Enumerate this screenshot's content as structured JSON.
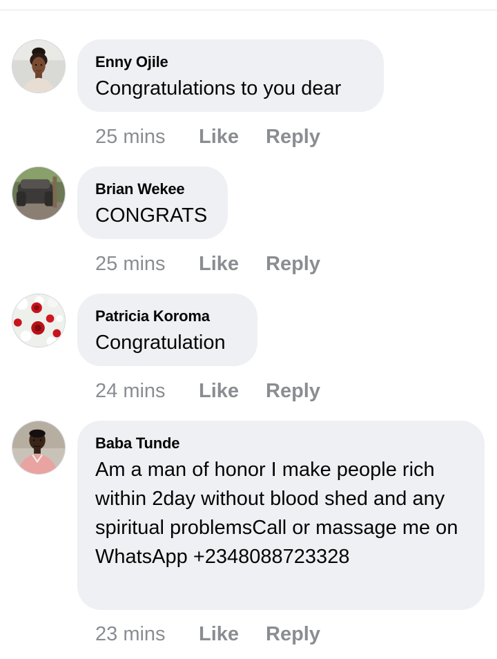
{
  "comments": [
    {
      "author": "Enny Ojile",
      "text": "Congratulations to you dear",
      "time": "25 mins",
      "like_label": "Like",
      "reply_label": "Reply",
      "avatar_icon": "profile-photo-woman"
    },
    {
      "author": "Brian Wekee",
      "text": "CONGRATS",
      "time": "25 mins",
      "like_label": "Like",
      "reply_label": "Reply",
      "avatar_icon": "profile-photo-sofa"
    },
    {
      "author": "Patricia Koroma",
      "text": "Congratulation",
      "time": "24 mins",
      "like_label": "Like",
      "reply_label": "Reply",
      "avatar_icon": "profile-photo-roses"
    },
    {
      "author": "Baba Tunde",
      "text": "Am a man of honor I make people rich within 2day without blood shed and any spiritual problemsCall or massage me on WhatsApp +2348088723328",
      "time": "23 mins",
      "like_label": "Like",
      "reply_label": "Reply",
      "avatar_icon": "profile-photo-man"
    }
  ],
  "colors": {
    "bubble_background": "#eff0f3",
    "text": "#050505",
    "secondary_text": "#8a8d91",
    "divider": "#e4e6eb"
  }
}
